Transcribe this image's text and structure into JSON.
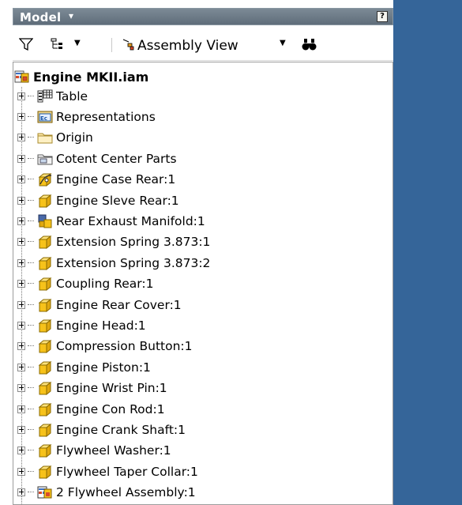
{
  "panel": {
    "title": "Model",
    "help": "?"
  },
  "toolbar": {
    "view_label": "Assembly View",
    "filter_icon": "filter-icon",
    "tree_icon": "tree-options-icon",
    "view_icon": "assembly-view-icon",
    "find_icon": "binoculars-icon"
  },
  "tree": {
    "root_label": "Engine MKII.iam",
    "items": [
      {
        "label": "Table",
        "icon": "table-icon"
      },
      {
        "label": "Representations",
        "icon": "representations-icon"
      },
      {
        "label": "Origin",
        "icon": "folder-icon"
      },
      {
        "label": "Cotent Center Parts",
        "icon": "content-center-folder-icon"
      },
      {
        "label": "Engine Case Rear:1",
        "icon": "flexible-part-icon"
      },
      {
        "label": "Engine Sleve Rear:1",
        "icon": "part-icon"
      },
      {
        "label": "Rear Exhaust Manifold:1",
        "icon": "subassembly-icon"
      },
      {
        "label": "Extension Spring 3.873:1",
        "icon": "part-icon"
      },
      {
        "label": "Extension Spring 3.873:2",
        "icon": "part-icon"
      },
      {
        "label": "Coupling Rear:1",
        "icon": "part-icon"
      },
      {
        "label": "Engine Rear Cover:1",
        "icon": "part-icon"
      },
      {
        "label": "Engine Head:1",
        "icon": "part-icon"
      },
      {
        "label": "Compression Button:1",
        "icon": "part-icon"
      },
      {
        "label": "Engine Piston:1",
        "icon": "part-icon"
      },
      {
        "label": "Engine Wrist Pin:1",
        "icon": "part-icon"
      },
      {
        "label": "Engine Con Rod:1",
        "icon": "part-icon"
      },
      {
        "label": "Engine Crank Shaft:1",
        "icon": "part-icon"
      },
      {
        "label": "Flywheel Washer:1",
        "icon": "part-icon"
      },
      {
        "label": "Flywheel Taper Collar:1",
        "icon": "part-icon"
      },
      {
        "label": "2 Flywheel Assembly:1",
        "icon": "assembly-table-icon"
      }
    ]
  },
  "colors": {
    "titlebar": "#6f7d8a",
    "right_panel": "#356599",
    "part_yellow": "#f7c21a"
  }
}
